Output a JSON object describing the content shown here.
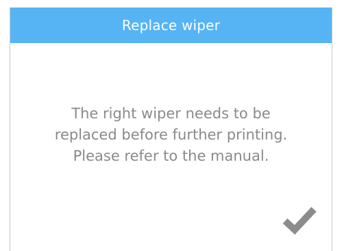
{
  "dialog": {
    "title": "Replace wiper",
    "message_lines": [
      "The right wiper needs to be",
      "replaced before further printing.",
      "Please refer to the manual."
    ],
    "confirm_icon": "checkmark-icon"
  },
  "colors": {
    "title_bar": "#56b4f5",
    "title_text": "#ffffff",
    "message_text": "#8a8a8a",
    "checkmark": "#8c8c8c"
  }
}
